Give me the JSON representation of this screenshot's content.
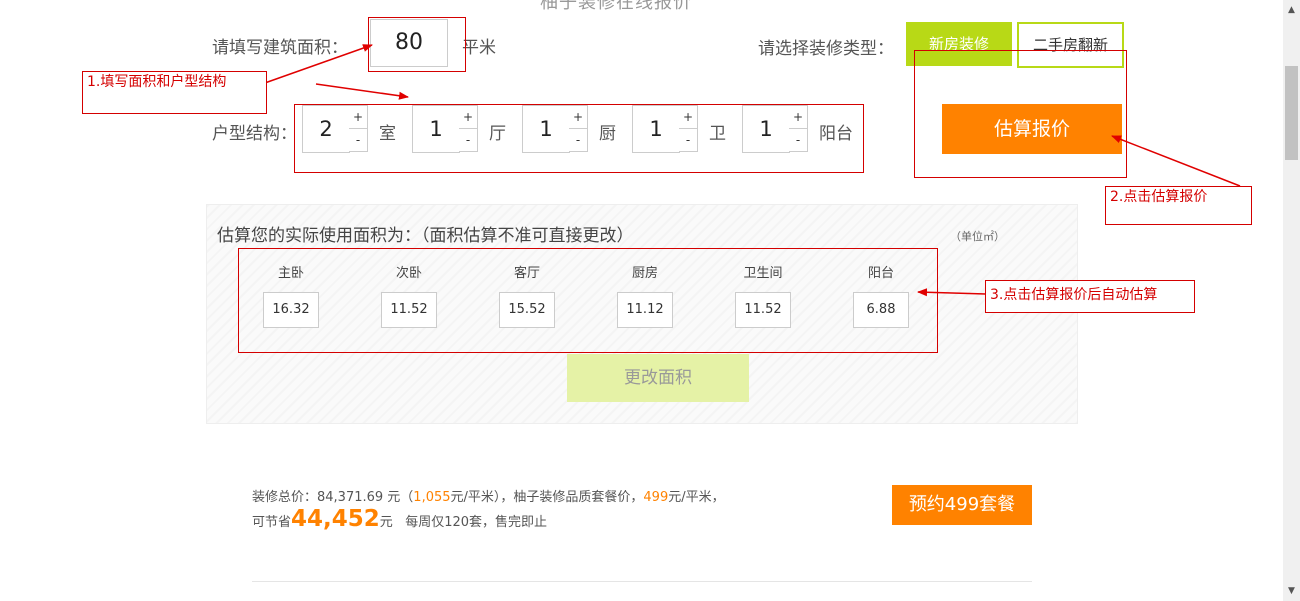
{
  "page": {
    "top_title": "柚子装修在线报价"
  },
  "area": {
    "label": "请填写建筑面积：",
    "value": "80",
    "unit": "平米"
  },
  "decor_type": {
    "label": "请选择装修类型：",
    "options": [
      "新房装修",
      "二手房翻新"
    ]
  },
  "layout": {
    "label": "户型结构：",
    "rooms": [
      {
        "value": "2",
        "unit": "室",
        "plus": "+",
        "minus": "-"
      },
      {
        "value": "1",
        "unit": "厅",
        "plus": "+",
        "minus": "-"
      },
      {
        "value": "1",
        "unit": "厨",
        "plus": "+",
        "minus": "-"
      },
      {
        "value": "1",
        "unit": "卫",
        "plus": "+",
        "minus": "-"
      },
      {
        "value": "1",
        "unit": "阳台",
        "plus": "+",
        "minus": "-"
      }
    ]
  },
  "estimate_button": "估算报价",
  "usage": {
    "title": "估算您的实际使用面积为：（面积估算不准可直接更改）",
    "unit_note": "（单位㎡）",
    "rooms": [
      {
        "name": "主卧",
        "value": "16.32"
      },
      {
        "name": "次卧",
        "value": "11.52"
      },
      {
        "name": "客厅",
        "value": "15.52"
      },
      {
        "name": "厨房",
        "value": "11.12"
      },
      {
        "name": "卫生间",
        "value": "11.52"
      },
      {
        "name": "阳台",
        "value": "6.88"
      }
    ],
    "change_button": "更改面积"
  },
  "price": {
    "total_prefix": "装修总价：84,371.69 元（",
    "per_sqm": "1,055",
    "per_sqm_unit": "元/平米），柚子装修品质套餐价，",
    "package_price": "499",
    "package_unit": "元/平米，",
    "save_prefix": "可节省",
    "save_amount": "44,452",
    "save_unit": "元",
    "note": "每周仅120套，售完即止"
  },
  "book_button": "预约499套餐",
  "annotations": {
    "step1": "1.填写面积和户型结构",
    "step2": "2.点击估算报价",
    "step3": "3.点击估算报价后自动估算"
  },
  "colors": {
    "accent_green": "#b8d916",
    "accent_orange": "#ff8200",
    "annotation_red": "#d40000"
  },
  "scrollbar": {
    "up_icon": "▲",
    "down_icon": "▼"
  }
}
